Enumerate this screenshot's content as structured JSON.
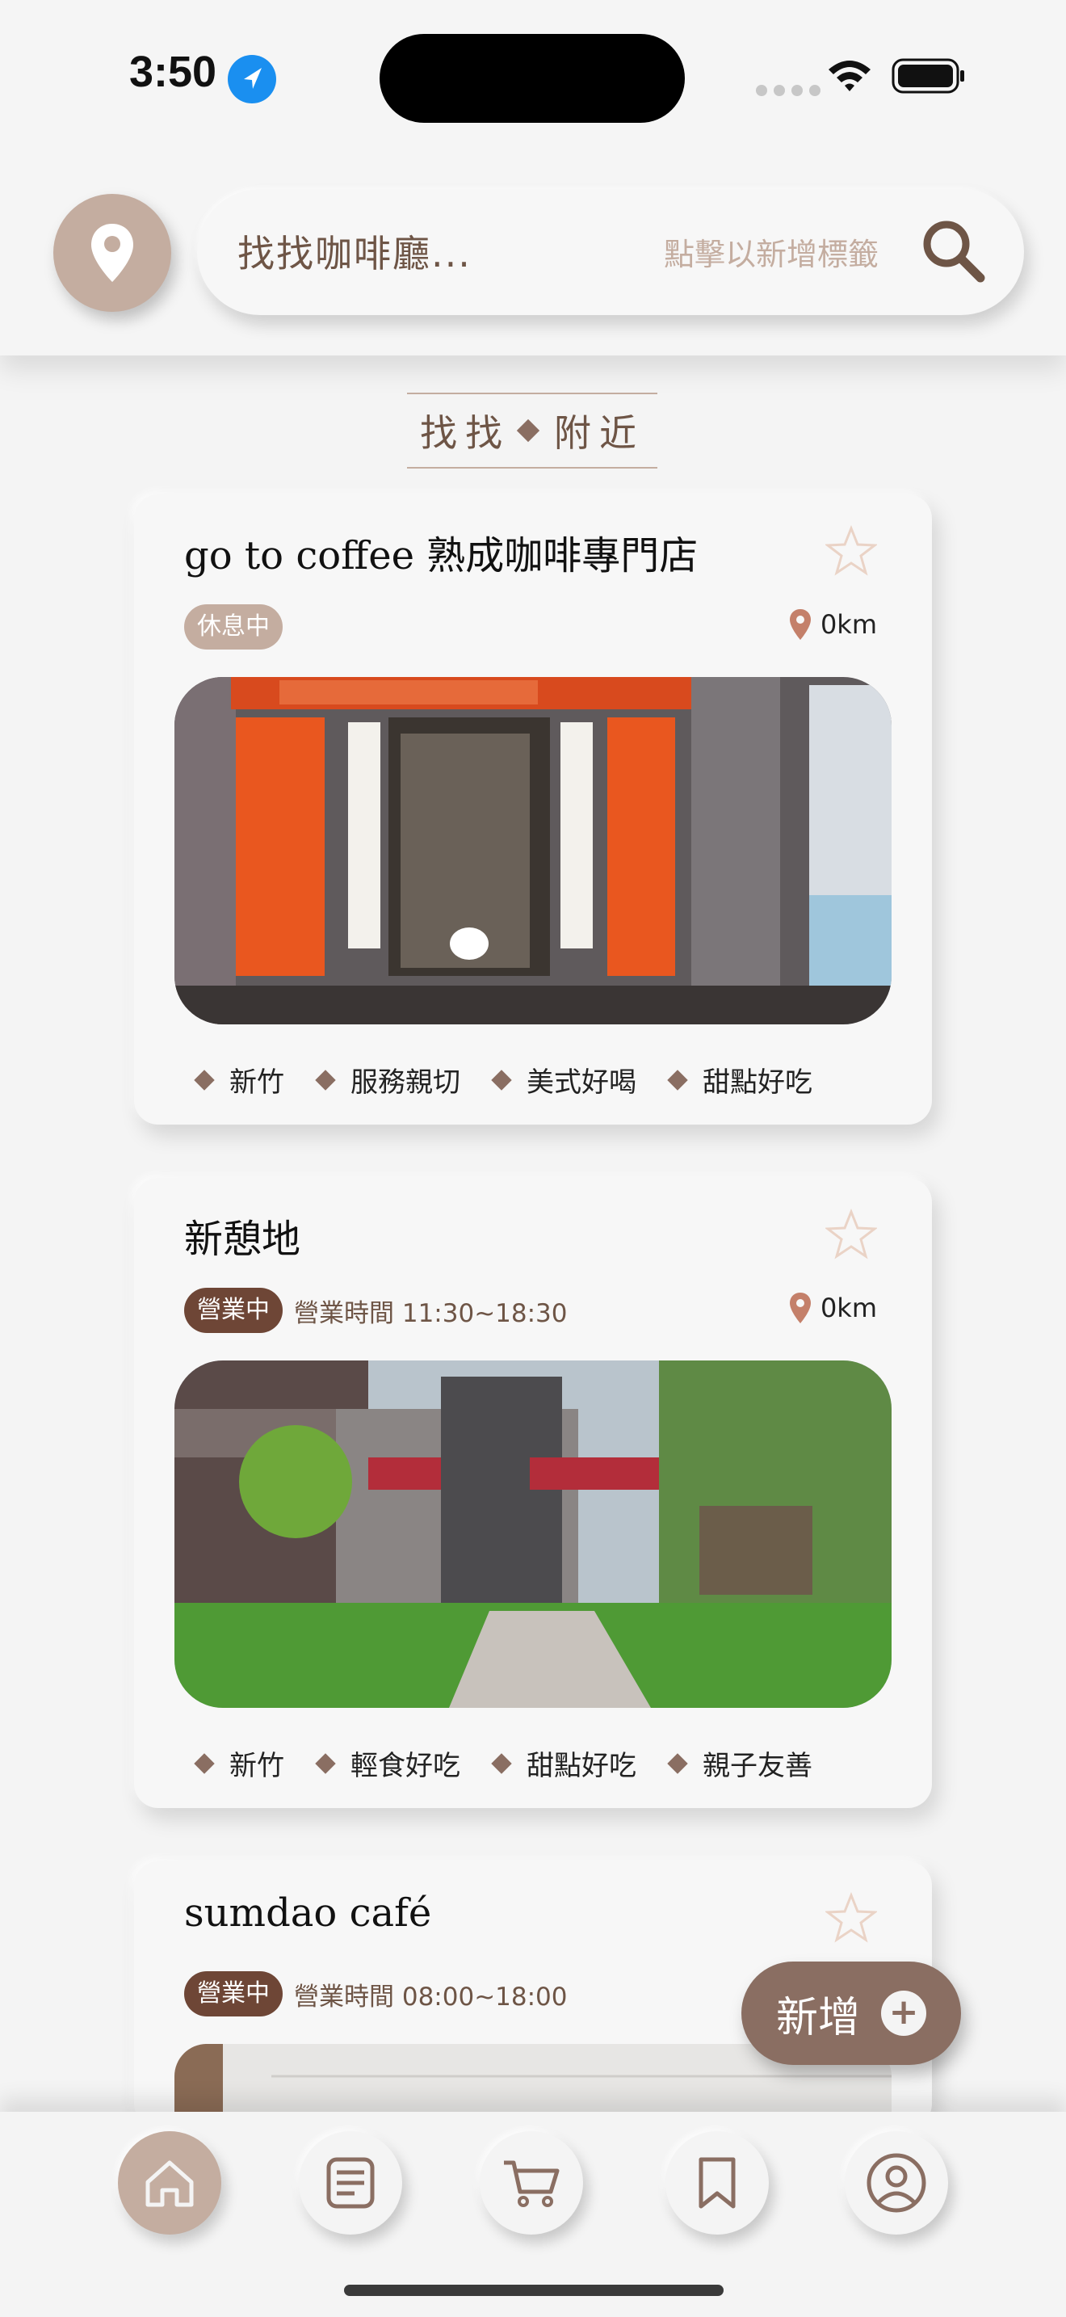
{
  "status_bar": {
    "time": "3:50"
  },
  "header": {
    "search_placeholder": "找找咖啡廳...",
    "tag_hint": "點擊以新增標籤"
  },
  "section": {
    "title_left": "找找",
    "title_right": "附近"
  },
  "colors": {
    "brand": "#8a6e62",
    "light_brand": "#c4ada0",
    "dark_brand": "#6e4636"
  },
  "cards": [
    {
      "title": "go to coffee 熟成咖啡專門店",
      "status": "休息中",
      "hours": "",
      "distance": "0km",
      "tags": [
        "新竹",
        "服務親切",
        "美式好喝",
        "甜點好吃"
      ]
    },
    {
      "title": "新憩地",
      "status": "營業中",
      "hours": "營業時間 11:30~18:30",
      "distance": "0km",
      "tags": [
        "新竹",
        "輕食好吃",
        "甜點好吃",
        "親子友善"
      ]
    },
    {
      "title": "sumdao café",
      "status": "營業中",
      "hours": "營業時間 08:00~18:00",
      "distance": "",
      "tags": []
    }
  ],
  "add_button": {
    "label": "新增"
  },
  "bottom_nav": {
    "items": [
      "home-icon",
      "list-icon",
      "cart-icon",
      "bookmark-icon",
      "profile-icon"
    ]
  }
}
